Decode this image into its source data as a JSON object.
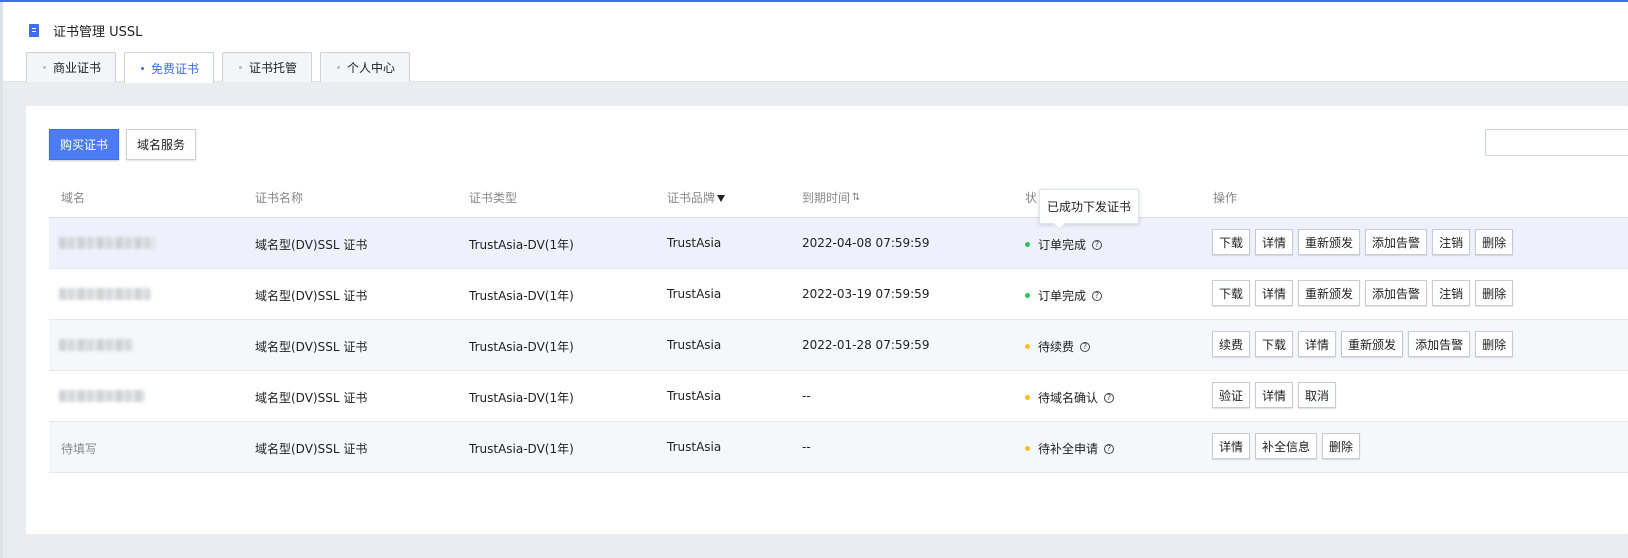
{
  "header": {
    "icon": "certificate-icon",
    "title": "证书管理 USSL"
  },
  "tabs": [
    {
      "label": "商业证书",
      "active": false
    },
    {
      "label": "免费证书",
      "active": true
    },
    {
      "label": "证书托管",
      "active": false
    },
    {
      "label": "个人中心",
      "active": false
    }
  ],
  "toolbar": {
    "buy_label": "购买证书",
    "domain_service_label": "域名服务",
    "search_placeholder": ""
  },
  "table": {
    "columns": {
      "domain": "域名",
      "cert_name": "证书名称",
      "cert_type": "证书类型",
      "brand": "证书品牌",
      "expiry": "到期时间",
      "status": "状",
      "actions": "操作"
    },
    "rows": [
      {
        "domain": "",
        "cert_name": "域名型(DV)SSL 证书",
        "cert_type": "TrustAsia-DV(1年)",
        "brand": "TrustAsia",
        "expiry": "2022-04-08 07:59:59",
        "status": "订单完成",
        "status_color": "#2fc25b",
        "actions": [
          "下载",
          "详情",
          "重新颁发",
          "添加告警",
          "注销",
          "删除"
        ]
      },
      {
        "domain": "",
        "cert_name": "域名型(DV)SSL 证书",
        "cert_type": "TrustAsia-DV(1年)",
        "brand": "TrustAsia",
        "expiry": "2022-03-19 07:59:59",
        "status": "订单完成",
        "status_color": "#2fc25b",
        "actions": [
          "下载",
          "详情",
          "重新颁发",
          "添加告警",
          "注销",
          "删除"
        ]
      },
      {
        "domain": "",
        "cert_name": "域名型(DV)SSL 证书",
        "cert_type": "TrustAsia-DV(1年)",
        "brand": "TrustAsia",
        "expiry": "2022-01-28 07:59:59",
        "status": "待续费",
        "status_color": "#f4c02a",
        "actions": [
          "续费",
          "下载",
          "详情",
          "重新颁发",
          "添加告警",
          "删除"
        ]
      },
      {
        "domain": "",
        "cert_name": "域名型(DV)SSL 证书",
        "cert_type": "TrustAsia-DV(1年)",
        "brand": "TrustAsia",
        "expiry": "--",
        "status": "待域名确认",
        "status_color": "#f4c02a",
        "actions": [
          "验证",
          "详情",
          "取消"
        ]
      },
      {
        "domain": "待填写",
        "cert_name": "域名型(DV)SSL 证书",
        "cert_type": "TrustAsia-DV(1年)",
        "brand": "TrustAsia",
        "expiry": "--",
        "status": "待补全申请",
        "status_color": "#f4c02a",
        "actions": [
          "详情",
          "补全信息",
          "删除"
        ]
      }
    ]
  },
  "tooltip": {
    "text": "已成功下发证书"
  },
  "colors": {
    "accent": "#3d6fea",
    "primary_button": "#4b7cf3",
    "status_done": "#2fc25b",
    "status_pending": "#f4c02a"
  }
}
